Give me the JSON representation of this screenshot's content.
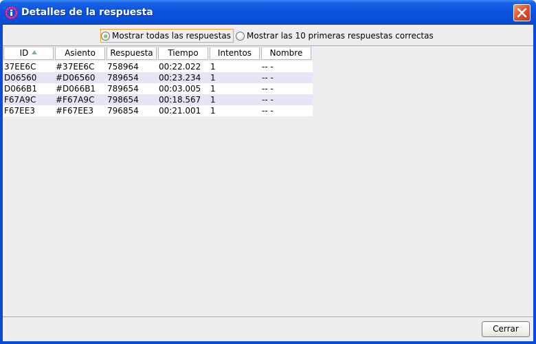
{
  "window": {
    "title": "Detalles de la respuesta"
  },
  "filters": {
    "options": [
      {
        "label": "Mostrar todas las respuestas",
        "selected": true
      },
      {
        "label": "Mostrar las 10 primeras respuestas correctas",
        "selected": false
      }
    ]
  },
  "table": {
    "columns": [
      "ID",
      "Asiento",
      "Respuesta",
      "Tiempo",
      "Intentos",
      "Nombre"
    ],
    "sorted_column": "ID",
    "rows": [
      [
        "37EE6C",
        "#37EE6C",
        "758964",
        "00:22.022",
        "1",
        "-- -"
      ],
      [
        "D06560",
        "#D06560",
        "789654",
        "00:23.234",
        "1",
        "-- -"
      ],
      [
        "D066B1",
        "#D066B1",
        "789654",
        "00:03.005",
        "1",
        "-- -"
      ],
      [
        "F67A9C",
        "#F67A9C",
        "798654",
        "00:18.567",
        "1",
        "-- -"
      ],
      [
        "F67EE3",
        "#F67EE3",
        "796854",
        "00:21.001",
        "1",
        "-- -"
      ]
    ]
  },
  "footer": {
    "close_label": "Cerrar"
  },
  "colors": {
    "titlebar": "#0a4fd8",
    "row_alt": "#e4e6f7",
    "selection_border": "#f0a030"
  }
}
